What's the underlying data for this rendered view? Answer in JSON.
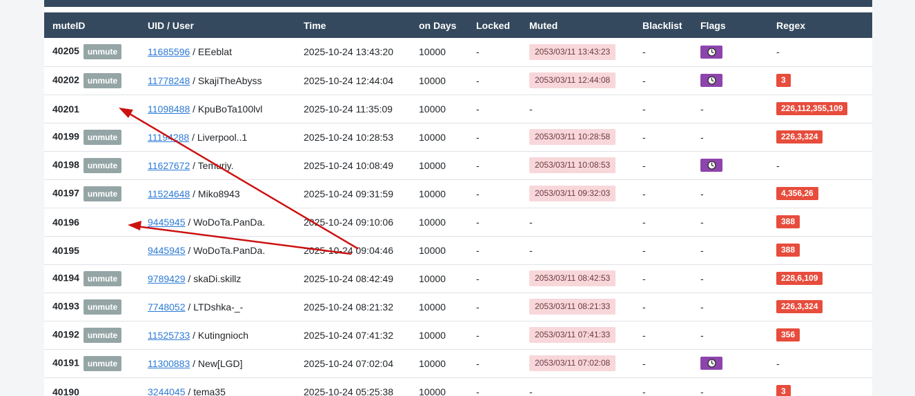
{
  "table": {
    "headers": {
      "muteid": "muteID",
      "user": "UID / User",
      "time": "Time",
      "days": "on Days",
      "locked": "Locked",
      "muted": "Muted",
      "blacklist": "Blacklist",
      "flags": "Flags",
      "regex": "Regex"
    },
    "unmute_label": "unmute",
    "separator": " / ",
    "empty": "-",
    "rows": [
      {
        "id": "40205",
        "unmute": true,
        "uid": "11685596",
        "user": "EEeblat",
        "time": "2025-10-24 13:43:20",
        "days": "10000",
        "locked": "-",
        "muted": "2053/03/11 13:43:23",
        "blacklist": "-",
        "flag": "clock-icon",
        "regex": ""
      },
      {
        "id": "40202",
        "unmute": true,
        "uid": "11778248",
        "user": "SkajiTheAbyss",
        "time": "2025-10-24 12:44:04",
        "days": "10000",
        "locked": "-",
        "muted": "2053/03/11 12:44:08",
        "blacklist": "-",
        "flag": "clock-icon",
        "regex": "3"
      },
      {
        "id": "40201",
        "unmute": false,
        "uid": "11098488",
        "user": "KpuBoTa100lvl",
        "time": "2025-10-24 11:35:09",
        "days": "10000",
        "locked": "-",
        "muted": "",
        "blacklist": "-",
        "flag": "",
        "regex": "226,112,355,109"
      },
      {
        "id": "40199",
        "unmute": true,
        "uid": "11194288",
        "user": "Liverpool..1",
        "time": "2025-10-24 10:28:53",
        "days": "10000",
        "locked": "-",
        "muted": "2053/03/11 10:28:58",
        "blacklist": "-",
        "flag": "",
        "regex": "226,3,324"
      },
      {
        "id": "40198",
        "unmute": true,
        "uid": "11627672",
        "user": "Temuriy.",
        "time": "2025-10-24 10:08:49",
        "days": "10000",
        "locked": "-",
        "muted": "2053/03/11 10:08:53",
        "blacklist": "-",
        "flag": "clock-icon",
        "regex": ""
      },
      {
        "id": "40197",
        "unmute": true,
        "uid": "11524648",
        "user": "Miko8943",
        "time": "2025-10-24 09:31:59",
        "days": "10000",
        "locked": "-",
        "muted": "2053/03/11 09:32:03",
        "blacklist": "-",
        "flag": "",
        "regex": "4,356,26"
      },
      {
        "id": "40196",
        "unmute": false,
        "uid": "9445945",
        "user": "WoDoTa.PanDa.",
        "time": "2025-10-24 09:10:06",
        "days": "10000",
        "locked": "-",
        "muted": "",
        "blacklist": "-",
        "flag": "",
        "regex": "388"
      },
      {
        "id": "40195",
        "unmute": false,
        "uid": "9445945",
        "user": "WoDoTa.PanDa.",
        "time": "2025-10-24 09:04:46",
        "days": "10000",
        "locked": "-",
        "muted": "",
        "blacklist": "-",
        "flag": "",
        "regex": "388"
      },
      {
        "id": "40194",
        "unmute": true,
        "uid": "9789429",
        "user": "skaDi.skillz",
        "time": "2025-10-24 08:42:49",
        "days": "10000",
        "locked": "-",
        "muted": "2053/03/11 08:42:53",
        "blacklist": "-",
        "flag": "",
        "regex": "228,6,109"
      },
      {
        "id": "40193",
        "unmute": true,
        "uid": "7748052",
        "user": "LTDshka-_-",
        "time": "2025-10-24 08:21:32",
        "days": "10000",
        "locked": "-",
        "muted": "2053/03/11 08:21:33",
        "blacklist": "-",
        "flag": "",
        "regex": "226,3,324"
      },
      {
        "id": "40192",
        "unmute": true,
        "uid": "11525733",
        "user": "Kutingnioch",
        "time": "2025-10-24 07:41:32",
        "days": "10000",
        "locked": "-",
        "muted": "2053/03/11 07:41:33",
        "blacklist": "-",
        "flag": "",
        "regex": "356"
      },
      {
        "id": "40191",
        "unmute": true,
        "uid": "11300883",
        "user": "New[LGD]",
        "time": "2025-10-24 07:02:04",
        "days": "10000",
        "locked": "-",
        "muted": "2053/03/11 07:02:08",
        "blacklist": "-",
        "flag": "clock-icon",
        "regex": ""
      },
      {
        "id": "40190",
        "unmute": false,
        "uid": "3244045",
        "user": "tema35",
        "time": "2025-10-24 05:25:38",
        "days": "10000",
        "locked": "-",
        "muted": "",
        "blacklist": "-",
        "flag": "",
        "regex": "3"
      }
    ]
  },
  "colors": {
    "header_bg": "#34495e",
    "unmute_bg": "#95a5a6",
    "muted_bg": "#f8d7da",
    "flag_bg": "#8e44ad",
    "regex_bg": "#e74c3c",
    "link": "#2c7ad6",
    "annotation": "#cc1111"
  }
}
